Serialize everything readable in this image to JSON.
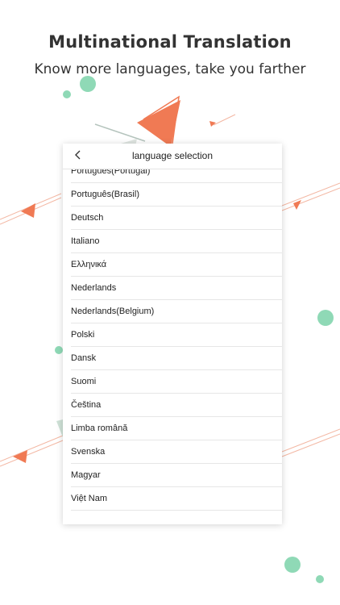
{
  "promo": {
    "headline": "Multinational Translation",
    "subline": "Know more languages, take you farther"
  },
  "dialog": {
    "title": "language selection",
    "back_icon": "chevron-left-icon",
    "languages": [
      "Português(Portugal)",
      "Português(Brasil)",
      "Deutsch",
      "Italiano",
      "Ελληνικά",
      "Nederlands",
      "Nederlands(Belgium)",
      "Polski",
      "Dansk",
      "Suomi",
      "Čeština",
      "Limba română",
      "Svenska",
      "Magyar",
      "Việt Nam"
    ]
  },
  "colors": {
    "accent_orange": "#f07a54",
    "accent_green": "#8fd9b6",
    "text": "#333333"
  }
}
